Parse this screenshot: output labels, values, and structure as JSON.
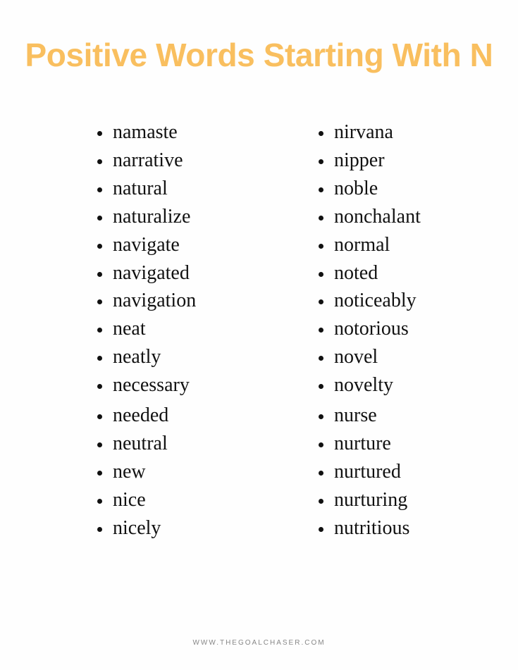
{
  "document": {
    "title": "Positive Words Starting With N",
    "background_color": "#fefefe",
    "title_color": "#f9bf5f",
    "text_color": "#111111"
  },
  "columns": {
    "left": {
      "words": [
        "namaste",
        "narrative",
        "natural",
        "naturalize",
        "navigate",
        "navigated",
        "navigation",
        "neat",
        "neatly",
        "necessary",
        "needed",
        "neutral",
        "new",
        "nice",
        "nicely"
      ]
    },
    "right": {
      "words": [
        "nirvana",
        "nipper",
        "noble",
        "nonchalant",
        "normal",
        "noted",
        "noticeably",
        "notorious",
        "novel",
        "novelty",
        "nurse",
        "nurture",
        "nurtured",
        "nurturing",
        "nutritious"
      ]
    }
  },
  "footer": {
    "text": "WWW.THEGOALCHASER.COM",
    "color": "#878787"
  }
}
